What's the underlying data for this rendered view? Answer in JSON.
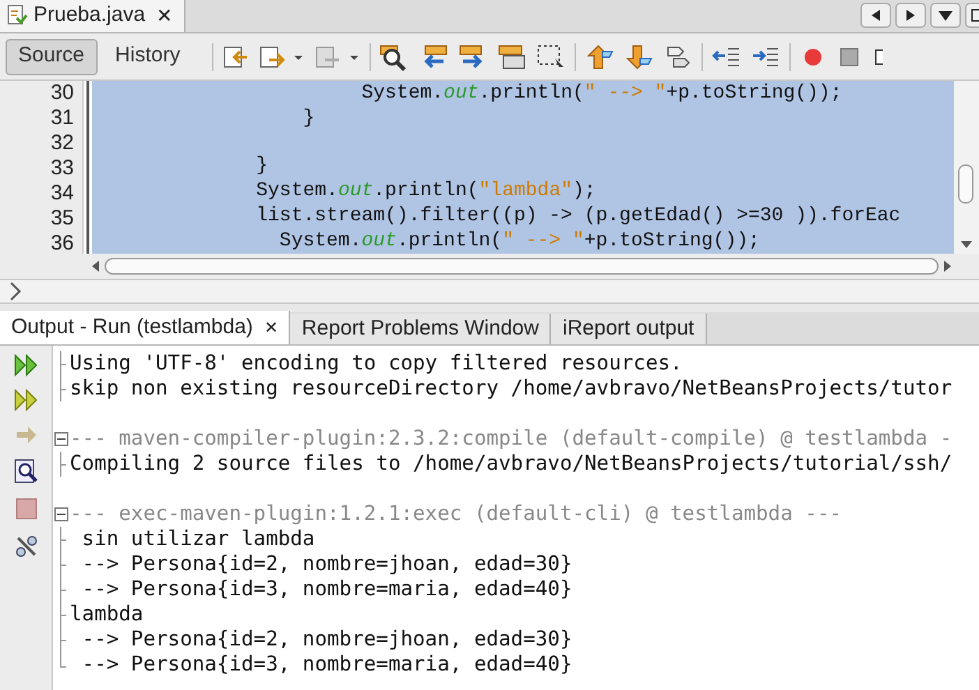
{
  "editor_tab": {
    "title": "Prueba.java",
    "close_glyph": "✕"
  },
  "view_tabs": [
    {
      "label": "Source",
      "selected": true
    },
    {
      "label": "History",
      "selected": false
    }
  ],
  "code_lines": [
    {
      "number": "30",
      "tokens": [
        {
          "text": "                       System.",
          "kind": "plain"
        },
        {
          "text": "out",
          "kind": "field"
        },
        {
          "text": ".println(",
          "kind": "plain"
        },
        {
          "text": "\" --> \"",
          "kind": "string"
        },
        {
          "text": "+p.toString());",
          "kind": "plain"
        }
      ]
    },
    {
      "number": "31",
      "tokens": [
        {
          "text": "                  }",
          "kind": "plain"
        }
      ]
    },
    {
      "number": "32"
    },
    {
      "number": "33",
      "tokens": [
        {
          "text": "              }",
          "kind": "plain"
        }
      ]
    },
    {
      "number": "34",
      "tokens": [
        {
          "text": "              System.",
          "kind": "plain"
        },
        {
          "text": "out",
          "kind": "field"
        },
        {
          "text": ".println(",
          "kind": "plain"
        },
        {
          "text": "\"lambda\"",
          "kind": "string"
        },
        {
          "text": ");",
          "kind": "plain"
        }
      ]
    },
    {
      "number": "35",
      "tokens": [
        {
          "text": "              list.stream().filter((p) -> (p.getEdad() >=30 )).forEac",
          "kind": "plain"
        }
      ]
    },
    {
      "number": "36",
      "tokens": [
        {
          "text": "                System.",
          "kind": "plain"
        },
        {
          "text": "out",
          "kind": "field"
        },
        {
          "text": ".println(",
          "kind": "plain"
        },
        {
          "text": "\" --> \"",
          "kind": "string"
        },
        {
          "text": "+p.toString());",
          "kind": "plain"
        }
      ]
    }
  ],
  "output_tabs": [
    {
      "label": "Output - Run (testlambda)",
      "selected": true,
      "close_glyph": "✕"
    },
    {
      "label": "Report Problems Window",
      "selected": false
    },
    {
      "label": "iReport output",
      "selected": false
    }
  ],
  "output_lines": [
    {
      "text": "Using 'UTF-8' encoding to copy filtered resources.",
      "kind": "plain"
    },
    {
      "text": "skip non existing resourceDirectory /home/avbravo/NetBeansProjects/tutor",
      "kind": "plain"
    },
    {
      "kind": "blank"
    },
    {
      "text": "--- maven-compiler-plugin:2.3.2:compile (default-compile) @ testlambda -",
      "kind": "header",
      "expanded": true
    },
    {
      "text": "Compiling 2 source files to /home/avbravo/NetBeansProjects/tutorial/ssh/",
      "kind": "plain"
    },
    {
      "kind": "blank"
    },
    {
      "text": "--- exec-maven-plugin:1.2.1:exec (default-cli) @ testlambda ---",
      "kind": "header",
      "expanded": true
    },
    {
      "text": " sin utilizar lambda",
      "kind": "plain"
    },
    {
      "text": " --> Persona{id=2, nombre=jhoan, edad=30}",
      "kind": "plain"
    },
    {
      "text": " --> Persona{id=3, nombre=maria, edad=40}",
      "kind": "plain"
    },
    {
      "text": "lambda",
      "kind": "plain"
    },
    {
      "text": " --> Persona{id=2, nombre=jhoan, edad=30}",
      "kind": "plain"
    },
    {
      "text": " --> Persona{id=3, nombre=maria, edad=40}",
      "kind": "plain"
    }
  ]
}
